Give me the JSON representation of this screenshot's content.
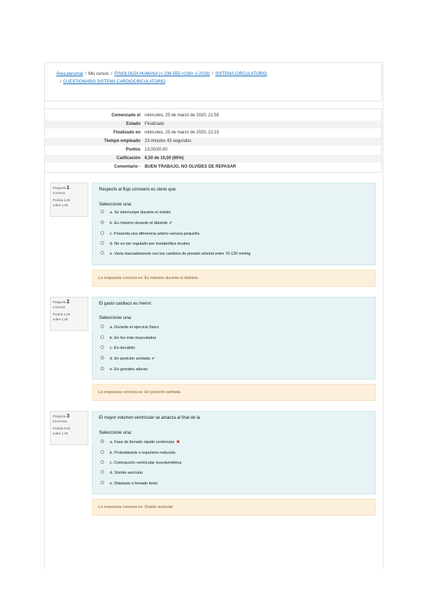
{
  "breadcrumb": {
    "items": [
      "Área personal",
      "Mis cursos",
      "FISIOLOGÍA HUMANA (+-236-555-+138+-1-2019)",
      "SISTEMA CIRCULATORIO",
      "CUESTIONARIO SISTEMA CARDIOCIRCULATORIO"
    ],
    "separator": "/"
  },
  "summary": {
    "rows": [
      {
        "label": "Comenzado el",
        "value": "miércoles, 25 de marzo de 2020, 21:59"
      },
      {
        "label": "Estado",
        "value": "Finalizado"
      },
      {
        "label": "Finalizado en",
        "value": "miércoles, 25 de marzo de 2020, 22:23"
      },
      {
        "label": "Tiempo empleado",
        "value": "23 minutos 43 segundos"
      },
      {
        "label": "Puntos",
        "value": "13,00/20,00"
      },
      {
        "label": "Calificación",
        "value": "6,50 de 10,00 (65%)"
      },
      {
        "label": "Comentario -",
        "value": "BUEN TRABAJO, NO OLVIDES DE REPASAR"
      }
    ]
  },
  "questions": [
    {
      "label": "Pregunta",
      "number": "1",
      "status": "Correcta",
      "score": "Puntúa 1,00",
      "out_of": "sobre 1,00",
      "text": "Respecto al flujo coronario es cierto que:",
      "prompt": "Seleccione una:",
      "options": [
        {
          "text": "a. Se interrumpe durante el sístole",
          "selected": false,
          "mark": ""
        },
        {
          "text": "b. Es máximo durante el diástole",
          "selected": true,
          "mark": "✔"
        },
        {
          "text": "c. Presenta una diferencia arterio-venosa pequeña",
          "selected": false,
          "mark": ""
        },
        {
          "text": "d. No es tan regulado por metabolitos locales",
          "selected": false,
          "mark": ""
        },
        {
          "text": "e. Varía marcadamente con los cambios de presión arterial entre 70-120 mmHg",
          "selected": false,
          "mark": ""
        }
      ],
      "feedback": "La respuesta correcta es: Es máximo durante el diástole"
    },
    {
      "label": "Pregunta",
      "number": "2",
      "status": "Correcta",
      "score": "Puntúa 1,00",
      "out_of": "sobre 1,00",
      "text": "El gasto cardiaco es menor:",
      "prompt": "Seleccione una:",
      "options": [
        {
          "text": "a. Durante el ejercicio físico",
          "selected": false,
          "mark": ""
        },
        {
          "text": "b. En los más musculados",
          "selected": false,
          "mark": ""
        },
        {
          "text": "c. En decúbito",
          "selected": false,
          "mark": ""
        },
        {
          "text": "d. En posición sentada",
          "selected": true,
          "mark": "✔"
        },
        {
          "text": "e. En grandes alturas",
          "selected": false,
          "mark": ""
        }
      ],
      "feedback": "La respuesta correcta es: En posición sentada"
    },
    {
      "label": "Pregunta",
      "number": "3",
      "status": "Incorrecta",
      "score": "Puntúa 0,00",
      "out_of": "sobre 1,00",
      "text": "El mayor volumen ventricular se alcanza al final de la",
      "prompt": "Seleccione una:",
      "options": [
        {
          "text": "a. Fase de llenado rápido ventricular",
          "selected": true,
          "mark": "✖"
        },
        {
          "text": "b. Protodiástole o expulsión reducida",
          "selected": false,
          "mark": ""
        },
        {
          "text": "c. Contracción ventricular isovolumétrica",
          "selected": false,
          "mark": ""
        },
        {
          "text": "d. Sístole auricular",
          "selected": false,
          "mark": ""
        },
        {
          "text": "e. Diástasis o llenado lento",
          "selected": false,
          "mark": ""
        }
      ],
      "feedback": "La respuesta correcta es: Sístole auricular"
    }
  ],
  "colors": {
    "link": "#0f6cbf",
    "question_bg": "#e7f3f5",
    "feedback_bg": "#fcefdc",
    "correct": "#357a32",
    "incorrect": "#ca3120"
  }
}
